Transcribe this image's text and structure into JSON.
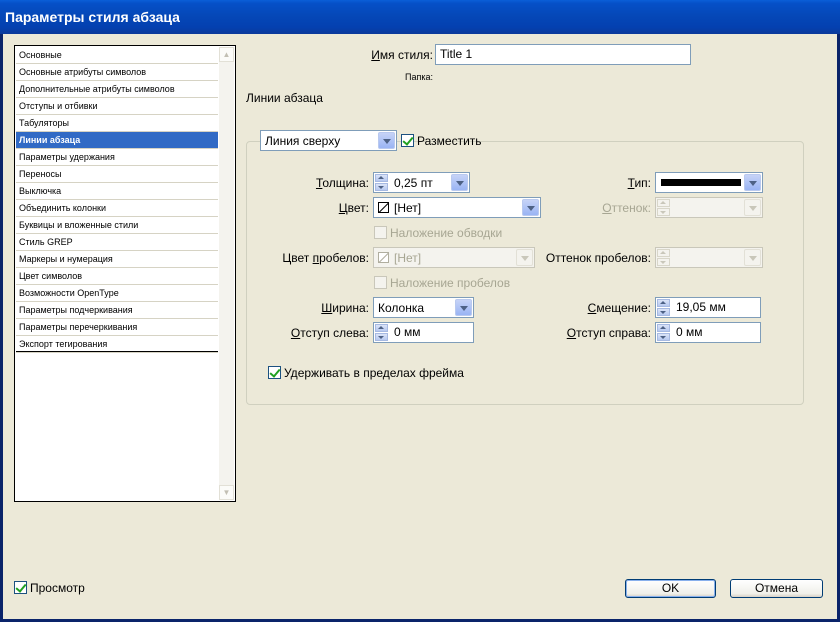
{
  "window": {
    "title": "Параметры стиля абзаца"
  },
  "categories": [
    "Основные",
    "Основные атрибуты символов",
    "Дополнительные атрибуты символов",
    "Отступы и отбивки",
    "Табуляторы",
    "Линии абзаца",
    "Параметры удержания",
    "Переносы",
    "Выключка",
    "Объединить колонки",
    "Буквицы и вложенные стили",
    "Стиль GREP",
    "Маркеры и нумерация",
    "Цвет символов",
    "Возможности OpenType",
    "Параметры подчеркивания",
    "Параметры перечеркивания",
    "Экспорт тегирования"
  ],
  "selected_category": "Линии абзаца",
  "style_name": {
    "label": "Имя стиля:",
    "value": "Title 1"
  },
  "folder": {
    "label": "Папка:"
  },
  "section_title": "Линии абзаца",
  "rule": {
    "position": "Линия сверху",
    "place_label": "Разместить",
    "place_checked": true,
    "weight_label": "Толщина:",
    "weight_value": "0,25 пт",
    "type_label": "Тип:",
    "color_label": "Цвет:",
    "color_value": "[Нет]",
    "tint_label": "Оттенок:",
    "overprint_stroke_label": "Наложение обводки",
    "gap_color_label": "Цвет пробелов:",
    "gap_color_value": "[Нет]",
    "gap_tint_label": "Оттенок пробелов:",
    "overprint_gap_label": "Наложение пробелов",
    "width_label": "Ширина:",
    "width_value": "Колонка",
    "offset_label": "Смещение:",
    "offset_value": "19,05 мм",
    "left_indent_label": "Отступ слева:",
    "left_indent_value": "0 мм",
    "right_indent_label": "Отступ справа:",
    "right_indent_value": "0 мм",
    "keep_in_frame_label": "Удерживать в пределах фрейма",
    "keep_in_frame_checked": true
  },
  "footer": {
    "preview_label": "Просмотр",
    "preview_checked": true,
    "ok_label": "OK",
    "cancel_label": "Отмена"
  },
  "colors": {
    "titlebar": "#0550c8",
    "dialog": "#ece9d8",
    "selection": "#316ac5"
  },
  "icons": [
    "spinner-icon",
    "dropdown-arrow-icon",
    "no-color-swatch-icon",
    "checkmark-icon"
  ]
}
